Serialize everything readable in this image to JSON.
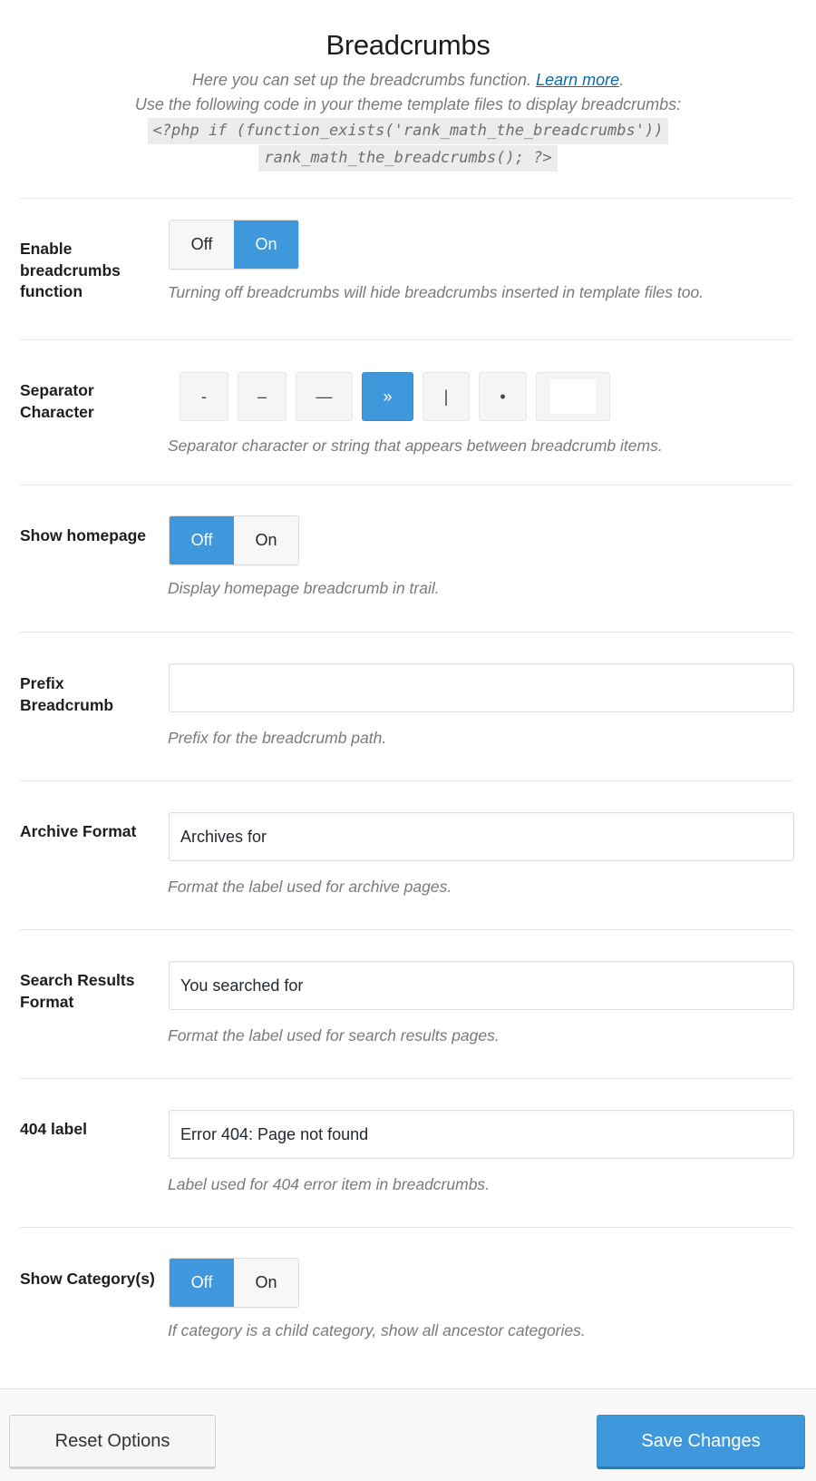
{
  "header": {
    "title": "Breadcrumbs",
    "desc_line1": "Here you can set up the breadcrumbs function. ",
    "learn_more": "Learn more",
    "desc_period": ".",
    "desc_line2": "Use the following code in your theme template files to display breadcrumbs:",
    "code_line1": "<?php if (function_exists('rank_math_the_breadcrumbs'))",
    "code_line2": "rank_math_the_breadcrumbs(); ?>"
  },
  "settings": {
    "enable": {
      "label": "Enable breadcrumbs function",
      "off": "Off",
      "on": "On",
      "value": "On",
      "help": "Turning off breadcrumbs will hide breadcrumbs inserted in template files too."
    },
    "separator": {
      "label": "Separator Character",
      "options": [
        "-",
        "–",
        "—",
        "»",
        "|",
        "•"
      ],
      "selected": "»",
      "custom_value": "",
      "help": "Separator character or string that appears between breadcrumb items."
    },
    "homepage": {
      "label": "Show homepage",
      "off": "Off",
      "on": "On",
      "value": "Off",
      "help": "Display homepage breadcrumb in trail."
    },
    "prefix": {
      "label": "Prefix Breadcrumb",
      "value": "",
      "help": "Prefix for the breadcrumb path."
    },
    "archive": {
      "label": "Archive Format",
      "value": "Archives for",
      "help": "Format the label used for archive pages."
    },
    "search": {
      "label": "Search Results Format",
      "value": "You searched for",
      "help": "Format the label used for search results pages."
    },
    "error404": {
      "label": "404 label",
      "value": "Error 404: Page not found",
      "help": "Label used for 404 error item in breadcrumbs."
    },
    "category": {
      "label": "Show Category(s)",
      "off": "Off",
      "on": "On",
      "value": "Off",
      "help": "If category is a child category, show all ancestor categories."
    }
  },
  "footer": {
    "reset_label": "Reset Options",
    "save_label": "Save Changes"
  },
  "colors": {
    "accent": "#3f98dc",
    "link": "#0b6aa8"
  }
}
